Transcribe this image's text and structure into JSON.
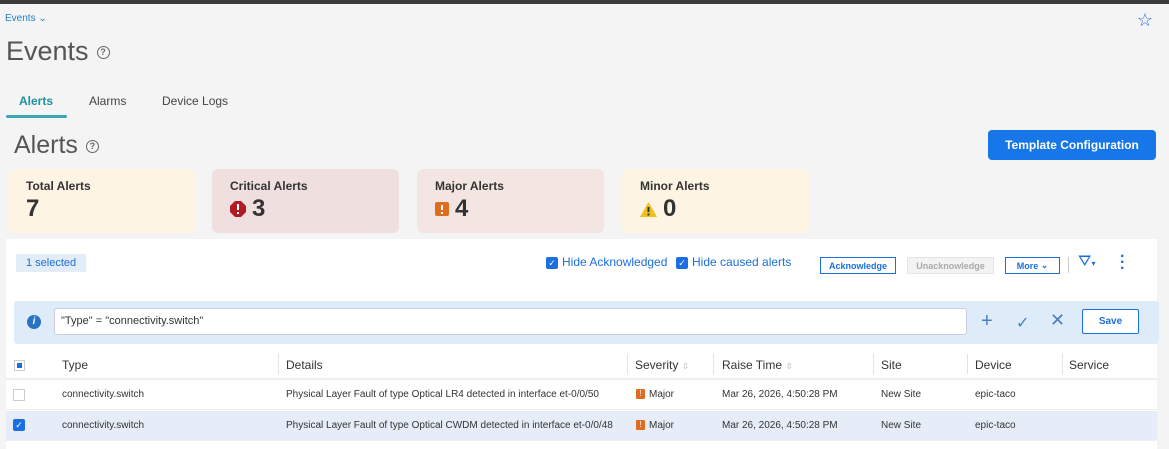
{
  "breadcrumb": "Events",
  "page_title": "Events",
  "tabs": [
    {
      "label": "Alerts",
      "active": true
    },
    {
      "label": "Alarms"
    },
    {
      "label": "Device Logs"
    }
  ],
  "section_title": "Alerts",
  "template_button": "Template Configuration",
  "cards": [
    {
      "label": "Total Alerts",
      "value": "7",
      "bg": "#fdf4e3"
    },
    {
      "label": "Critical Alerts",
      "value": "3",
      "bg": "#efdfdf",
      "icon": "critical-octagon-icon",
      "color": "#b01c24"
    },
    {
      "label": "Major Alerts",
      "value": "4",
      "bg": "#f3e6e2",
      "icon": "major-square-icon",
      "color": "#e06c1e"
    },
    {
      "label": "Minor Alerts",
      "value": "0",
      "bg": "#fdf4e3",
      "icon": "warning-triangle-icon",
      "color": "#f0c020"
    }
  ],
  "toolbar": {
    "selected": "1 selected",
    "hide_ack": "Hide Acknowledged",
    "hide_caused": "Hide caused alerts",
    "acknowledge": "Acknowledge",
    "unacknowledge": "Unacknowledge",
    "more": "More"
  },
  "filter": {
    "query": "\"Type\" = \"connectivity.switch\"",
    "save": "Save"
  },
  "table": {
    "columns": [
      "Type",
      "Details",
      "Severity",
      "Raise Time",
      "Site",
      "Device",
      "Service"
    ],
    "rows": [
      {
        "checked": false,
        "type": "connectivity.switch",
        "details": "Physical Layer Fault of type Optical LR4 detected in interface et-0/0/50",
        "severity": "Major",
        "time": "Mar 26, 2026, 4:50:28 PM",
        "site": "New Site",
        "device": "epic-taco",
        "service": ""
      },
      {
        "checked": true,
        "type": "connectivity.switch",
        "details": "Physical Layer Fault of type Optical CWDM detected in interface et-0/0/48",
        "severity": "Major",
        "time": "Mar 26, 2026, 4:50:28 PM",
        "site": "New Site",
        "device": "epic-taco",
        "service": ""
      }
    ]
  }
}
